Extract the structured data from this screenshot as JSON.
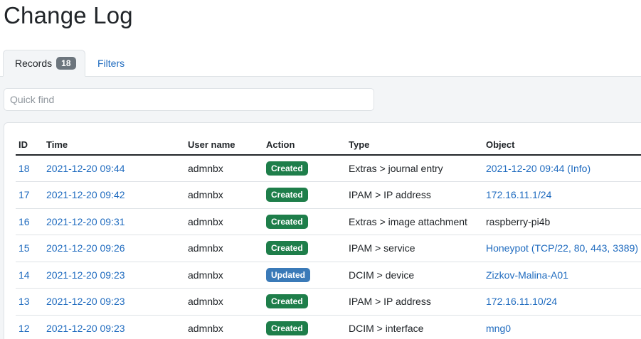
{
  "page": {
    "title": "Change Log"
  },
  "tabs": {
    "records": {
      "label": "Records",
      "count": "18"
    },
    "filters": {
      "label": "Filters"
    }
  },
  "search": {
    "placeholder": "Quick find",
    "value": ""
  },
  "colors": {
    "created": "#1e7e4a",
    "updated": "#3a7ab8",
    "link": "#1f6bbf"
  },
  "table": {
    "headers": [
      "ID",
      "Time",
      "User name",
      "Action",
      "Type",
      "Object"
    ],
    "rows": [
      {
        "id": "18",
        "time": "2021-12-20 09:44",
        "user": "admnbx",
        "action": "Created",
        "type": "Extras > journal entry",
        "object": "2021-12-20 09:44 (Info)",
        "object_link": true
      },
      {
        "id": "17",
        "time": "2021-12-20 09:42",
        "user": "admnbx",
        "action": "Created",
        "type": "IPAM > IP address",
        "object": "172.16.11.1/24",
        "object_link": true
      },
      {
        "id": "16",
        "time": "2021-12-20 09:31",
        "user": "admnbx",
        "action": "Created",
        "type": "Extras > image attachment",
        "object": "raspberry-pi4b",
        "object_link": false
      },
      {
        "id": "15",
        "time": "2021-12-20 09:26",
        "user": "admnbx",
        "action": "Created",
        "type": "IPAM > service",
        "object": "Honeypot (TCP/22, 80, 443, 3389)",
        "object_link": true
      },
      {
        "id": "14",
        "time": "2021-12-20 09:23",
        "user": "admnbx",
        "action": "Updated",
        "type": "DCIM > device",
        "object": "Zizkov-Malina-A01",
        "object_link": true
      },
      {
        "id": "13",
        "time": "2021-12-20 09:23",
        "user": "admnbx",
        "action": "Created",
        "type": "IPAM > IP address",
        "object": "172.16.11.10/24",
        "object_link": true
      },
      {
        "id": "12",
        "time": "2021-12-20 09:23",
        "user": "admnbx",
        "action": "Created",
        "type": "DCIM > interface",
        "object": "mng0",
        "object_link": true
      }
    ]
  }
}
